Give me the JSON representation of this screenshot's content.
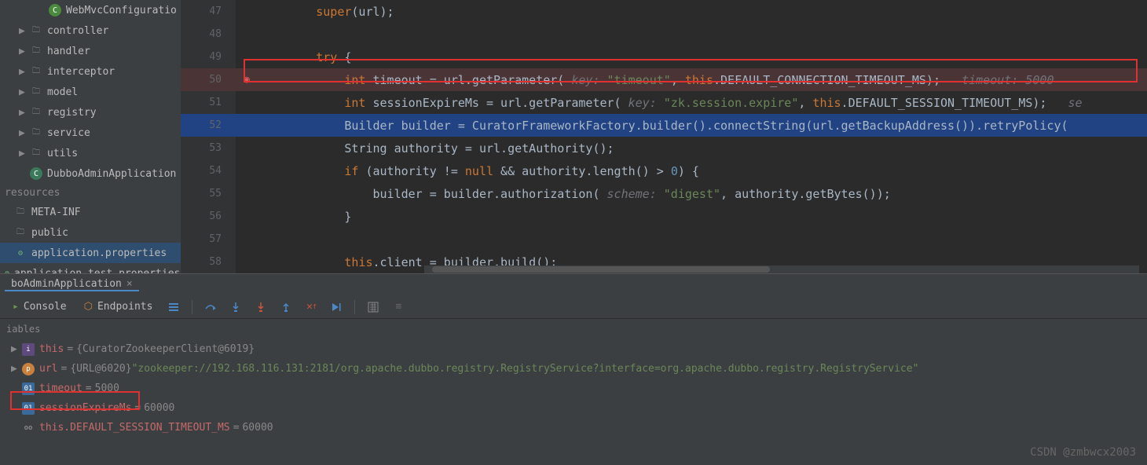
{
  "sidebar": {
    "items": [
      {
        "label": "WebMvcConfiguratio",
        "indent": 2,
        "icon": "class-c",
        "chev": ""
      },
      {
        "label": "controller",
        "indent": 1,
        "icon": "folder",
        "chev": "▶"
      },
      {
        "label": "handler",
        "indent": 1,
        "icon": "folder",
        "chev": "▶"
      },
      {
        "label": "interceptor",
        "indent": 1,
        "icon": "folder",
        "chev": "▶"
      },
      {
        "label": "model",
        "indent": 1,
        "icon": "folder",
        "chev": "▶"
      },
      {
        "label": "registry",
        "indent": 1,
        "icon": "folder",
        "chev": "▶"
      },
      {
        "label": "service",
        "indent": 1,
        "icon": "folder",
        "chev": "▶"
      },
      {
        "label": "utils",
        "indent": 1,
        "icon": "folder",
        "chev": "▶"
      },
      {
        "label": "DubboAdminApplication",
        "indent": 1,
        "icon": "class-r",
        "chev": ""
      }
    ],
    "resources_header": "resources",
    "resources": [
      {
        "label": "META-INF",
        "icon": "folder"
      },
      {
        "label": "public",
        "icon": "folder"
      },
      {
        "label": "application.properties",
        "icon": "props",
        "selected": true
      },
      {
        "label": "application-test.properties",
        "icon": "props"
      }
    ]
  },
  "editor": {
    "lines": [
      {
        "n": 47,
        "segs": [
          {
            "t": "        ",
            "c": ""
          },
          {
            "t": "super",
            "c": "kw"
          },
          {
            "t": "(url);",
            "c": ""
          }
        ]
      },
      {
        "n": 48,
        "segs": []
      },
      {
        "n": 49,
        "segs": [
          {
            "t": "        ",
            "c": ""
          },
          {
            "t": "try",
            "c": "kw"
          },
          {
            "t": " {",
            "c": ""
          }
        ]
      },
      {
        "n": 50,
        "exec": true,
        "bp": true,
        "segs": [
          {
            "t": "            ",
            "c": ""
          },
          {
            "t": "int",
            "c": "kw"
          },
          {
            "t": " timeout = url.getParameter( ",
            "c": ""
          },
          {
            "t": "key:",
            "c": "param"
          },
          {
            "t": " ",
            "c": ""
          },
          {
            "t": "\"timeout\"",
            "c": "str"
          },
          {
            "t": ", ",
            "c": ""
          },
          {
            "t": "this",
            "c": "this"
          },
          {
            "t": ".DEFAULT_CONNECTION_TIMEOUT_MS);   ",
            "c": ""
          },
          {
            "t": "timeout: 5000",
            "c": "hint"
          }
        ]
      },
      {
        "n": 51,
        "segs": [
          {
            "t": "            ",
            "c": ""
          },
          {
            "t": "int",
            "c": "kw"
          },
          {
            "t": " sessionExpireMs = url.getParameter( ",
            "c": ""
          },
          {
            "t": "key:",
            "c": "param"
          },
          {
            "t": " ",
            "c": ""
          },
          {
            "t": "\"zk.session.expire\"",
            "c": "str"
          },
          {
            "t": ", ",
            "c": ""
          },
          {
            "t": "this",
            "c": "this"
          },
          {
            "t": ".DEFAULT_SESSION_TIMEOUT_MS);   ",
            "c": ""
          },
          {
            "t": "se",
            "c": "hint"
          }
        ]
      },
      {
        "n": 52,
        "sel": true,
        "segs": [
          {
            "t": "            Builder builder = CuratorFrameworkFactory.builder().connectString(url.getBackupAddress()).retryPolicy(",
            "c": ""
          }
        ]
      },
      {
        "n": 53,
        "segs": [
          {
            "t": "            String authority = url.getAuthority();",
            "c": ""
          }
        ]
      },
      {
        "n": 54,
        "segs": [
          {
            "t": "            ",
            "c": ""
          },
          {
            "t": "if",
            "c": "kw"
          },
          {
            "t": " (authority != ",
            "c": ""
          },
          {
            "t": "null",
            "c": "kw"
          },
          {
            "t": " && authority.length() > ",
            "c": ""
          },
          {
            "t": "0",
            "c": "num"
          },
          {
            "t": ") {",
            "c": ""
          }
        ]
      },
      {
        "n": 55,
        "segs": [
          {
            "t": "                builder = builder.authorization( ",
            "c": ""
          },
          {
            "t": "scheme:",
            "c": "param"
          },
          {
            "t": " ",
            "c": ""
          },
          {
            "t": "\"digest\"",
            "c": "str"
          },
          {
            "t": ", authority.getBytes());",
            "c": ""
          }
        ]
      },
      {
        "n": 56,
        "segs": [
          {
            "t": "            }",
            "c": ""
          }
        ]
      },
      {
        "n": 57,
        "segs": []
      },
      {
        "n": 58,
        "segs": [
          {
            "t": "            ",
            "c": ""
          },
          {
            "t": "this",
            "c": "this"
          },
          {
            "t": ".client = builder.build();",
            "c": ""
          }
        ]
      }
    ]
  },
  "run_tab": {
    "label": "boAdminApplication"
  },
  "toolbar": {
    "console": "Console",
    "endpoints": "Endpoints"
  },
  "debug": {
    "header": "iables",
    "rows": [
      {
        "arrow": "▶",
        "ico": "this",
        "name": "this",
        "val": "{CuratorZookeeperClient@6019}",
        "str": ""
      },
      {
        "arrow": "▶",
        "ico": "p",
        "name": "url",
        "val": "{URL@6020}",
        "str": " \"zookeeper://192.168.116.131:2181/org.apache.dubbo.registry.RegistryService?interface=org.apache.dubbo.registry.RegistryService\""
      },
      {
        "arrow": "",
        "ico": "int",
        "name": "timeout",
        "val": "5000",
        "str": ""
      },
      {
        "arrow": "",
        "ico": "int",
        "name": "sessionExpireMs",
        "val": "60000",
        "str": ""
      },
      {
        "arrow": "",
        "ico": "oo",
        "name": "this.DEFAULT_SESSION_TIMEOUT_MS",
        "val": "60000",
        "str": ""
      }
    ]
  },
  "watermark": "CSDN @zmbwcx2003"
}
